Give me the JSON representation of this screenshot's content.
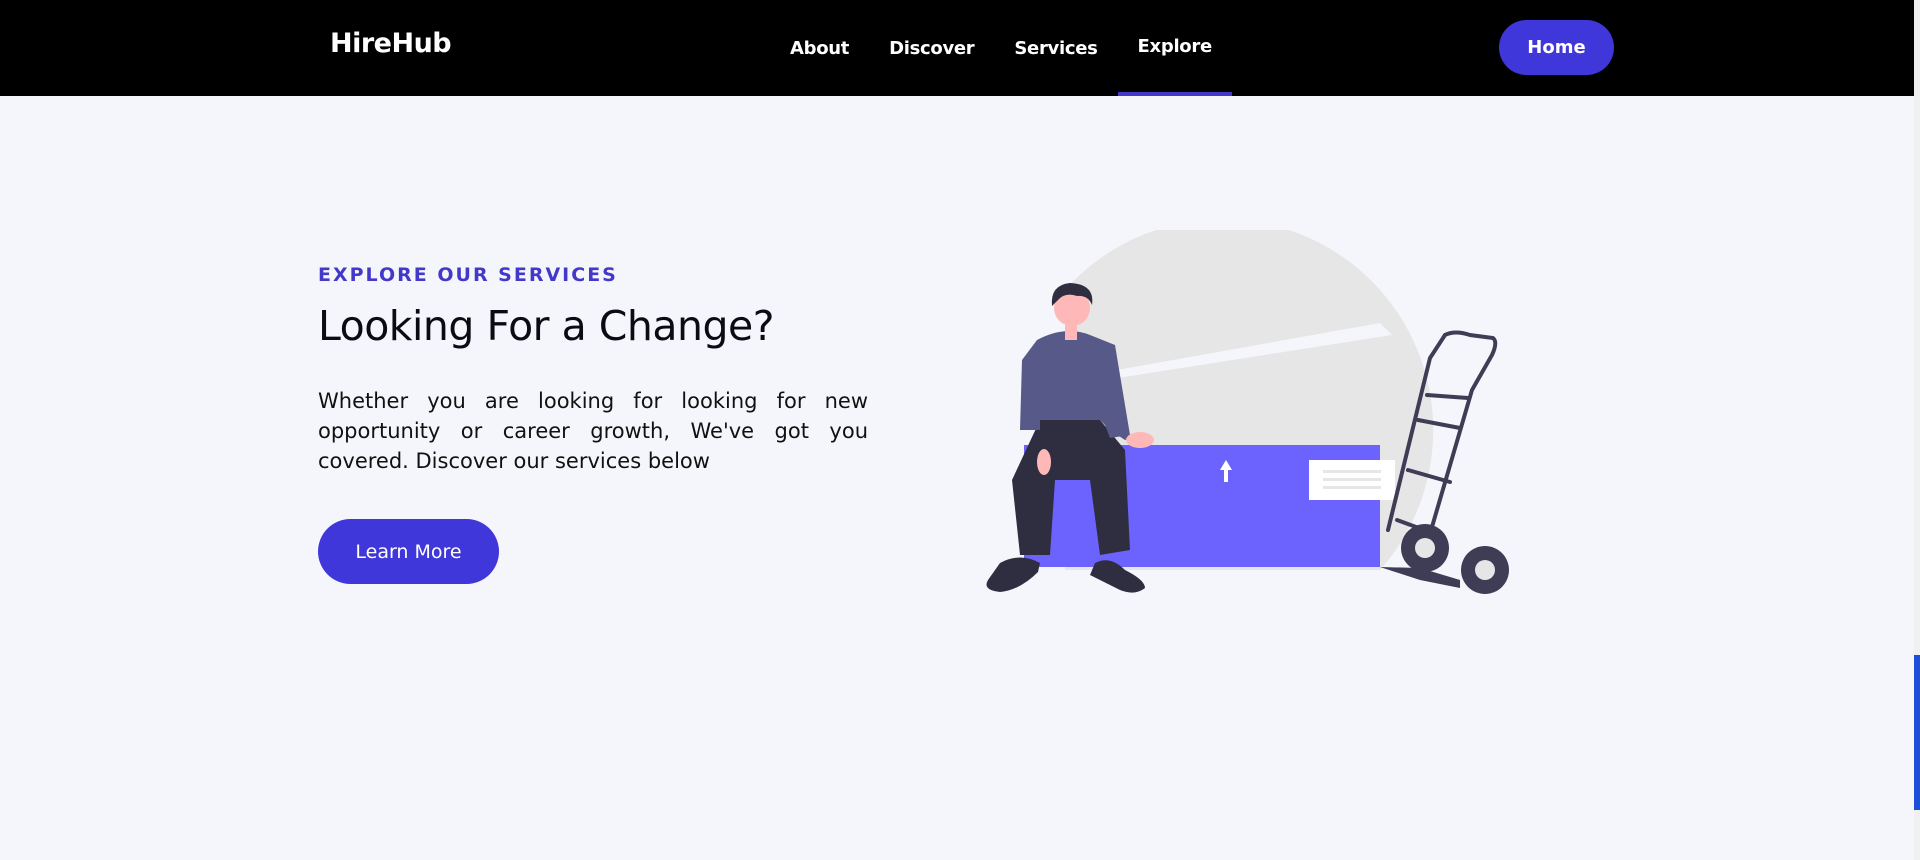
{
  "navbar": {
    "logo": "HireHub",
    "links": [
      {
        "label": "About"
      },
      {
        "label": "Discover"
      },
      {
        "label": "Services"
      },
      {
        "label": "Explore",
        "active": true
      }
    ],
    "home_label": "Home"
  },
  "hero": {
    "eyebrow": "EXPLORE OUR SERVICES",
    "headline": "Looking For a Change?",
    "description": "Whether you are looking for looking for new opportunity or career growth, We've got you covered. Discover our services below",
    "cta_label": "Learn More"
  },
  "illustration": {
    "subject": "person-sitting-on-box-with-hand-truck",
    "colors": {
      "box": "#6c63ff",
      "arc": "#e6e6e6",
      "shirt": "#575a89",
      "pants": "#2f2e41",
      "skin": "#ffb8b8",
      "truck": "#3f3d56"
    }
  },
  "colors": {
    "accent": "#3f37d9",
    "nav_bg": "#000000",
    "page_bg": "#f5f6fb",
    "eyebrow": "#4338ca"
  }
}
